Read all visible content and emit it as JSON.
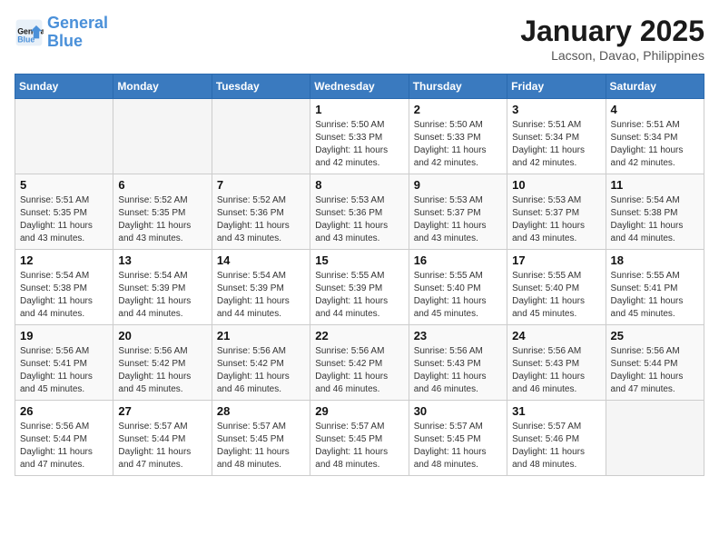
{
  "header": {
    "logo_line1": "General",
    "logo_line2": "Blue",
    "month_title": "January 2025",
    "location": "Lacson, Davao, Philippines"
  },
  "days_of_week": [
    "Sunday",
    "Monday",
    "Tuesday",
    "Wednesday",
    "Thursday",
    "Friday",
    "Saturday"
  ],
  "weeks": [
    [
      {
        "day": "",
        "info": ""
      },
      {
        "day": "",
        "info": ""
      },
      {
        "day": "",
        "info": ""
      },
      {
        "day": "1",
        "info": "Sunrise: 5:50 AM\nSunset: 5:33 PM\nDaylight: 11 hours\nand 42 minutes."
      },
      {
        "day": "2",
        "info": "Sunrise: 5:50 AM\nSunset: 5:33 PM\nDaylight: 11 hours\nand 42 minutes."
      },
      {
        "day": "3",
        "info": "Sunrise: 5:51 AM\nSunset: 5:34 PM\nDaylight: 11 hours\nand 42 minutes."
      },
      {
        "day": "4",
        "info": "Sunrise: 5:51 AM\nSunset: 5:34 PM\nDaylight: 11 hours\nand 42 minutes."
      }
    ],
    [
      {
        "day": "5",
        "info": "Sunrise: 5:51 AM\nSunset: 5:35 PM\nDaylight: 11 hours\nand 43 minutes."
      },
      {
        "day": "6",
        "info": "Sunrise: 5:52 AM\nSunset: 5:35 PM\nDaylight: 11 hours\nand 43 minutes."
      },
      {
        "day": "7",
        "info": "Sunrise: 5:52 AM\nSunset: 5:36 PM\nDaylight: 11 hours\nand 43 minutes."
      },
      {
        "day": "8",
        "info": "Sunrise: 5:53 AM\nSunset: 5:36 PM\nDaylight: 11 hours\nand 43 minutes."
      },
      {
        "day": "9",
        "info": "Sunrise: 5:53 AM\nSunset: 5:37 PM\nDaylight: 11 hours\nand 43 minutes."
      },
      {
        "day": "10",
        "info": "Sunrise: 5:53 AM\nSunset: 5:37 PM\nDaylight: 11 hours\nand 43 minutes."
      },
      {
        "day": "11",
        "info": "Sunrise: 5:54 AM\nSunset: 5:38 PM\nDaylight: 11 hours\nand 44 minutes."
      }
    ],
    [
      {
        "day": "12",
        "info": "Sunrise: 5:54 AM\nSunset: 5:38 PM\nDaylight: 11 hours\nand 44 minutes."
      },
      {
        "day": "13",
        "info": "Sunrise: 5:54 AM\nSunset: 5:39 PM\nDaylight: 11 hours\nand 44 minutes."
      },
      {
        "day": "14",
        "info": "Sunrise: 5:54 AM\nSunset: 5:39 PM\nDaylight: 11 hours\nand 44 minutes."
      },
      {
        "day": "15",
        "info": "Sunrise: 5:55 AM\nSunset: 5:39 PM\nDaylight: 11 hours\nand 44 minutes."
      },
      {
        "day": "16",
        "info": "Sunrise: 5:55 AM\nSunset: 5:40 PM\nDaylight: 11 hours\nand 45 minutes."
      },
      {
        "day": "17",
        "info": "Sunrise: 5:55 AM\nSunset: 5:40 PM\nDaylight: 11 hours\nand 45 minutes."
      },
      {
        "day": "18",
        "info": "Sunrise: 5:55 AM\nSunset: 5:41 PM\nDaylight: 11 hours\nand 45 minutes."
      }
    ],
    [
      {
        "day": "19",
        "info": "Sunrise: 5:56 AM\nSunset: 5:41 PM\nDaylight: 11 hours\nand 45 minutes."
      },
      {
        "day": "20",
        "info": "Sunrise: 5:56 AM\nSunset: 5:42 PM\nDaylight: 11 hours\nand 45 minutes."
      },
      {
        "day": "21",
        "info": "Sunrise: 5:56 AM\nSunset: 5:42 PM\nDaylight: 11 hours\nand 46 minutes."
      },
      {
        "day": "22",
        "info": "Sunrise: 5:56 AM\nSunset: 5:42 PM\nDaylight: 11 hours\nand 46 minutes."
      },
      {
        "day": "23",
        "info": "Sunrise: 5:56 AM\nSunset: 5:43 PM\nDaylight: 11 hours\nand 46 minutes."
      },
      {
        "day": "24",
        "info": "Sunrise: 5:56 AM\nSunset: 5:43 PM\nDaylight: 11 hours\nand 46 minutes."
      },
      {
        "day": "25",
        "info": "Sunrise: 5:56 AM\nSunset: 5:44 PM\nDaylight: 11 hours\nand 47 minutes."
      }
    ],
    [
      {
        "day": "26",
        "info": "Sunrise: 5:56 AM\nSunset: 5:44 PM\nDaylight: 11 hours\nand 47 minutes."
      },
      {
        "day": "27",
        "info": "Sunrise: 5:57 AM\nSunset: 5:44 PM\nDaylight: 11 hours\nand 47 minutes."
      },
      {
        "day": "28",
        "info": "Sunrise: 5:57 AM\nSunset: 5:45 PM\nDaylight: 11 hours\nand 48 minutes."
      },
      {
        "day": "29",
        "info": "Sunrise: 5:57 AM\nSunset: 5:45 PM\nDaylight: 11 hours\nand 48 minutes."
      },
      {
        "day": "30",
        "info": "Sunrise: 5:57 AM\nSunset: 5:45 PM\nDaylight: 11 hours\nand 48 minutes."
      },
      {
        "day": "31",
        "info": "Sunrise: 5:57 AM\nSunset: 5:46 PM\nDaylight: 11 hours\nand 48 minutes."
      },
      {
        "day": "",
        "info": ""
      }
    ]
  ]
}
